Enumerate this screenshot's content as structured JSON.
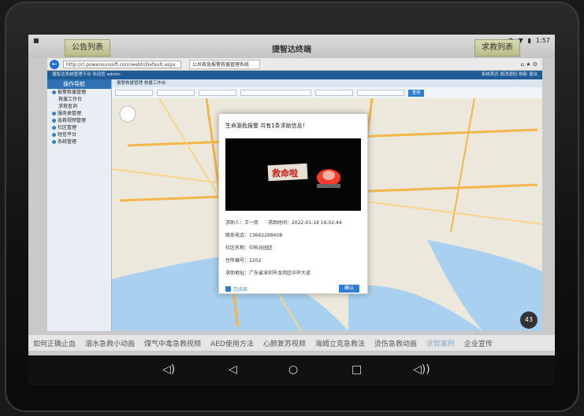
{
  "status_bar": {
    "left": "■",
    "time": "1:57"
  },
  "app": {
    "title": "捷智达终端",
    "left_tab": "公告列表",
    "right_tab": "求救列表"
  },
  "browser": {
    "url": "http://cl.powersunsoft.com/webh/Default.aspx",
    "tab_title": "公共救急报警救援管理系统",
    "topbar_left": "捷智达系统管理平台  欢迎您 admin",
    "topbar_right": "系统首页  修改密码  刷新  退出"
  },
  "sidebar": {
    "header": "操作导航",
    "items": [
      "报警救援管理",
      "救援工作台",
      "求救查询",
      "服务类管理",
      "急救视频管理",
      "社区管理",
      "短信平台",
      "系统管理"
    ]
  },
  "main": {
    "breadcrumb": "报警救援管理 救援工作台",
    "search_button": "查询"
  },
  "modal": {
    "title": "生命源危报警   共有1条求助信息！",
    "image_text": "救命啦",
    "requester_label": "求助人：",
    "requester": "王一民",
    "time_label": "求助时间：",
    "time": "2022-01-19 16:02:44",
    "phone_label": "联系电话：",
    "phone": "13662298408",
    "community_label": "社区名称：",
    "community": "中科谷园区",
    "residence_label": "住所编号：",
    "residence": "2202",
    "address_label": "求助地址：",
    "address": "广东省深圳市龙岗区中环大道",
    "read_label": "已阅读",
    "ok_button": "确认"
  },
  "bottom_links": [
    "如何正确止血",
    "溺水急救小动画",
    "煤气中毒急救视频",
    "AED使用方法",
    "心肺复苏视频",
    "海姆立克急救法",
    "烫伤急救动画",
    "求智案例",
    "企业宣传"
  ],
  "active_bottom_link": 7,
  "speed": "43"
}
